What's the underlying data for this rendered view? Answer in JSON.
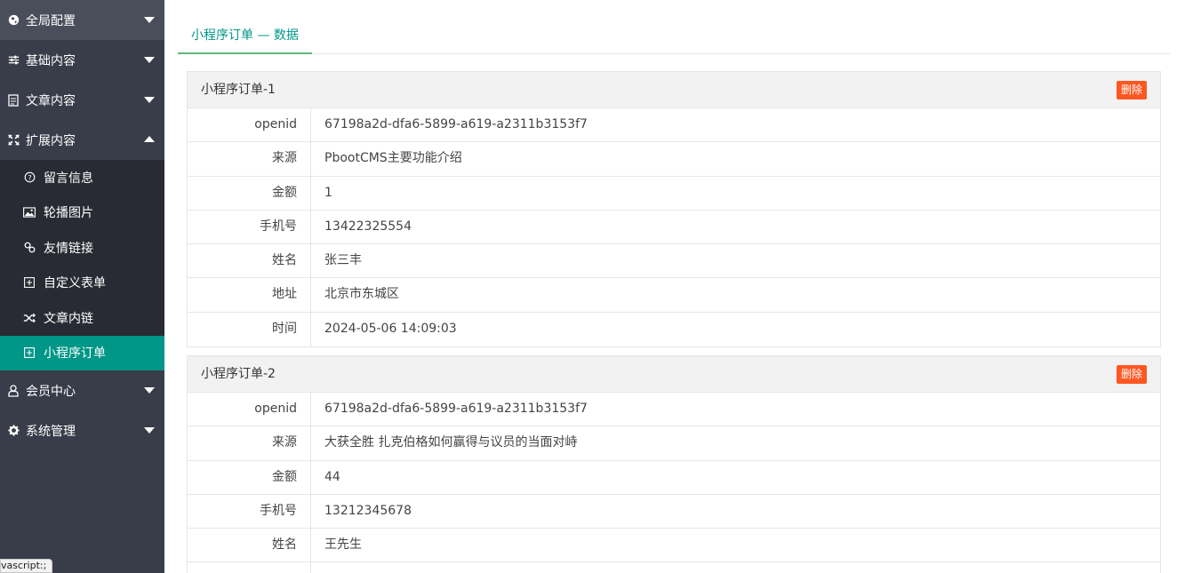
{
  "sidebar": {
    "items": [
      {
        "label": "全局配置",
        "icon": "globe-icon"
      },
      {
        "label": "基础内容",
        "icon": "sliders-icon"
      },
      {
        "label": "文章内容",
        "icon": "document-icon"
      },
      {
        "label": "扩展内容",
        "icon": "expand-icon"
      }
    ],
    "subitems": [
      {
        "label": "留言信息",
        "icon": "question-icon"
      },
      {
        "label": "轮播图片",
        "icon": "image-icon"
      },
      {
        "label": "友情链接",
        "icon": "link-icon"
      },
      {
        "label": "自定义表单",
        "icon": "plus-square-icon"
      },
      {
        "label": "文章内链",
        "icon": "shuffle-icon"
      },
      {
        "label": "小程序订单",
        "icon": "plus-square-icon"
      }
    ],
    "bottom_items": [
      {
        "label": "会员中心",
        "icon": "user-icon"
      },
      {
        "label": "系统管理",
        "icon": "gear-icon"
      }
    ],
    "status_tip": "vascript:;"
  },
  "main": {
    "tab_label": "小程序订单 — 数据",
    "orders": [
      {
        "title": "小程序订单-1",
        "delete_label": "删除",
        "fields": [
          {
            "key": "openid",
            "value": "67198a2d-dfa6-5899-a619-a2311b3153f7"
          },
          {
            "key": "来源",
            "value": "PbootCMS主要功能介绍"
          },
          {
            "key": "金额",
            "value": "1"
          },
          {
            "key": "手机号",
            "value": "13422325554"
          },
          {
            "key": "姓名",
            "value": "张三丰"
          },
          {
            "key": "地址",
            "value": "北京市东城区"
          },
          {
            "key": "时间",
            "value": "2024-05-06 14:09:03"
          }
        ]
      },
      {
        "title": "小程序订单-2",
        "delete_label": "删除",
        "fields": [
          {
            "key": "openid",
            "value": "67198a2d-dfa6-5899-a619-a2311b3153f7"
          },
          {
            "key": "来源",
            "value": "大获全胜 扎克伯格如何赢得与议员的当面对峙"
          },
          {
            "key": "金额",
            "value": "44"
          },
          {
            "key": "手机号",
            "value": "13212345678"
          },
          {
            "key": "姓名",
            "value": "王先生"
          },
          {
            "key": "",
            "value": ""
          }
        ]
      }
    ]
  },
  "colors": {
    "sidebar_bg": "#393d49",
    "subnav_bg": "#282b33",
    "active": "#009688",
    "delete": "#ff5722"
  }
}
